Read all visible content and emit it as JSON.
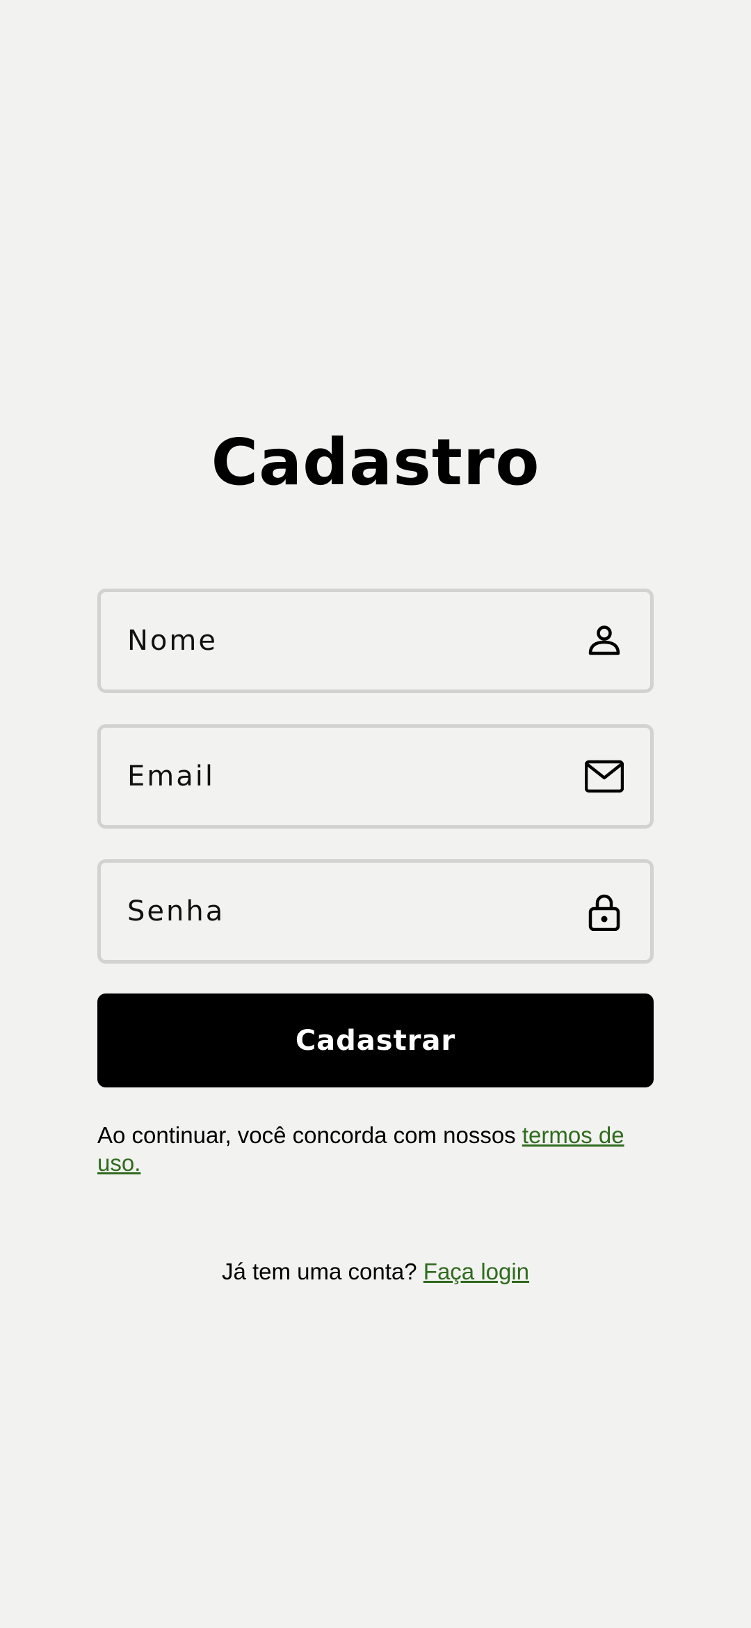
{
  "page": {
    "title": "Cadastro"
  },
  "form": {
    "name_placeholder": "Nome",
    "name_value": "",
    "name_icon": "user-icon",
    "email_placeholder": "Email",
    "email_value": "",
    "email_icon": "mail-icon",
    "password_placeholder": "Senha",
    "password_value": "",
    "password_icon": "lock-icon",
    "submit_label": "Cadastrar"
  },
  "terms": {
    "text": "Ao continuar, você concorda com nossos ",
    "link_label": "termos de uso."
  },
  "login": {
    "text": "Já tem uma conta? ",
    "link_label": "Faça login"
  },
  "colors": {
    "background": "#f2f2f0",
    "field_border": "#d2d2d0",
    "button_bg": "#000000",
    "button_text": "#ffffff",
    "link": "#2f6b1e"
  }
}
